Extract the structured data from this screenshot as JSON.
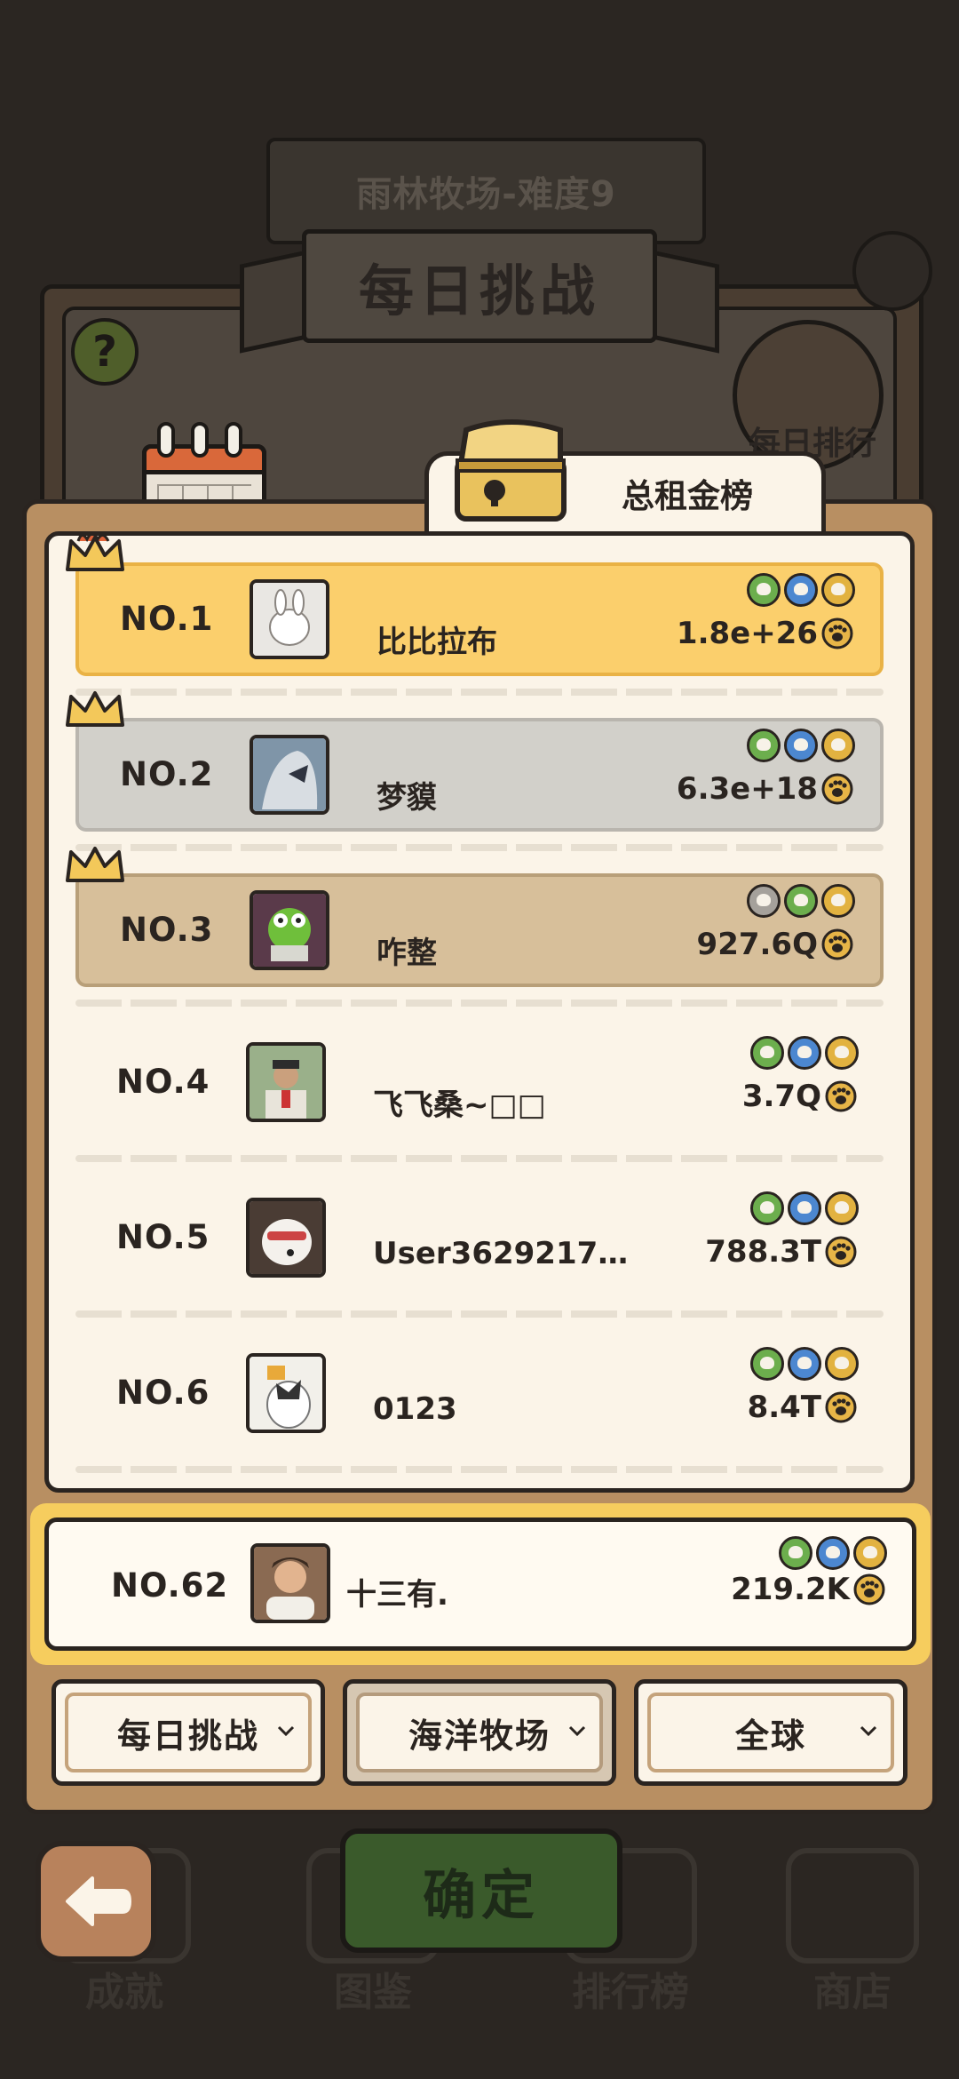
{
  "background": {
    "stage_title": "雨林牧场-难度9",
    "banner_title": "每日挑战",
    "side_label": "每日排行",
    "nav": [
      {
        "label": "成就"
      },
      {
        "label": "图鉴"
      },
      {
        "label": "排行榜"
      },
      {
        "label": "商店"
      }
    ]
  },
  "tab": {
    "label": "总租金榜"
  },
  "leaderboard": [
    {
      "rank": "NO.1",
      "name": "比比拉布",
      "score": "1.8e+26",
      "tier": "gold",
      "badges": [
        "green",
        "blue",
        "gold"
      ]
    },
    {
      "rank": "NO.2",
      "name": "梦貘",
      "score": "6.3e+18",
      "tier": "silver",
      "badges": [
        "green",
        "blue",
        "gold"
      ]
    },
    {
      "rank": "NO.3",
      "name": "咋整",
      "score": "927.6Q",
      "tier": "bronze",
      "badges": [
        "gray",
        "green",
        "gold"
      ]
    },
    {
      "rank": "NO.4",
      "name": "飞飞桑~□□",
      "score": "3.7Q",
      "tier": "none",
      "badges": [
        "green",
        "blue",
        "gold"
      ]
    },
    {
      "rank": "NO.5",
      "name": "User3629217…",
      "score": "788.3T",
      "tier": "none",
      "badges": [
        "green",
        "blue",
        "gold"
      ]
    },
    {
      "rank": "NO.6",
      "name": "0123",
      "score": "8.4T",
      "tier": "none",
      "badges": [
        "green",
        "blue",
        "gold"
      ]
    }
  ],
  "self": {
    "rank": "NO.62",
    "name": "十三有.",
    "score": "219.2K",
    "badges": [
      "green",
      "blue",
      "gold"
    ]
  },
  "filters": [
    {
      "label": "每日挑战",
      "active": false
    },
    {
      "label": "海洋牧场",
      "active": true
    },
    {
      "label": "全球",
      "active": false
    }
  ],
  "buttons": {
    "confirm": "确定"
  },
  "colors": {
    "gold_row": "#fbcf6c",
    "silver_row": "#d2d0ca",
    "bronze_row": "#d7bf9a",
    "panel": "#b88f62",
    "self_highlight": "#f6cd5e"
  }
}
